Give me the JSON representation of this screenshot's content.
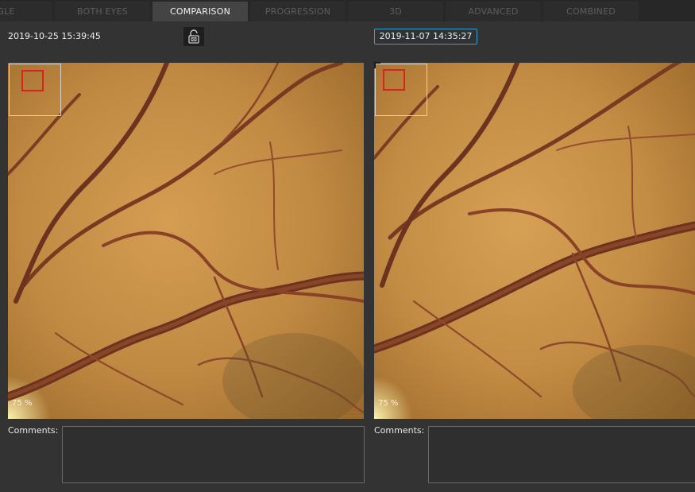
{
  "tabs": [
    {
      "label": "NGLE",
      "active": false
    },
    {
      "label": "BOTH EYES",
      "active": false
    },
    {
      "label": "COMPARISON",
      "active": true
    },
    {
      "label": "PROGRESSION",
      "active": false
    },
    {
      "label": "3D",
      "active": false
    },
    {
      "label": "ADVANCED",
      "active": false
    },
    {
      "label": "COMBINED",
      "active": false
    }
  ],
  "left": {
    "date": "2019-10-25 15:39:45",
    "zoom": "75 %",
    "comments_label": "Comments:"
  },
  "right": {
    "date": "2019-11-07 14:35:27",
    "zoom": "75 %",
    "comments_label": "Comments:"
  },
  "icons": {
    "lock": "unlock-icon"
  },
  "colors": {
    "accent": "#3b9ed0",
    "roi": "#d8231e",
    "active_tab": "#444444"
  }
}
